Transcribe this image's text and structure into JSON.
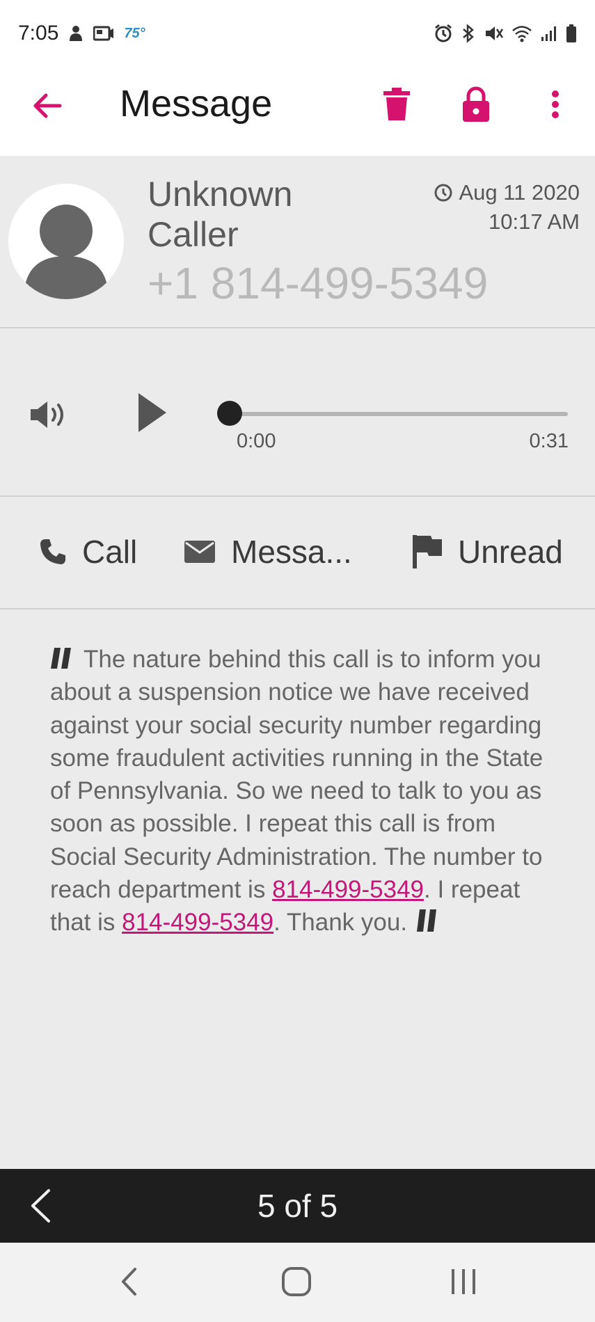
{
  "status_bar": {
    "time": "7:05",
    "temperature": "75°",
    "icons": [
      "profile-icon",
      "news-icon",
      "alarm-icon",
      "bluetooth-icon",
      "mute-icon",
      "wifi-icon",
      "signal-icon",
      "battery-icon"
    ]
  },
  "app_bar": {
    "title": "Message",
    "accent_color": "#d6126f",
    "icons": [
      "back-arrow-icon",
      "trash-icon",
      "lock-icon",
      "more-vert-icon"
    ]
  },
  "caller": {
    "name": "Unknown Caller",
    "number": "+1 814-499-5349",
    "date": "Aug 11 2020",
    "time": "10:17 AM"
  },
  "player": {
    "position": "0:00",
    "duration": "0:31",
    "progress": 0
  },
  "actions": {
    "call": "Call",
    "message": "Messa...",
    "unread": "Unread"
  },
  "transcript": {
    "part1": "The nature behind this call is to inform you about a suspension notice we have received against your social security number regarding some fraudulent activities running in the State of Pennsylvania. So we need to talk to you as soon as possible. I repeat this call is from Social Security Administration. The number to reach department is ",
    "link1": "814-499-5349",
    "part2": ". I repeat that is ",
    "link2": "814-499-5349",
    "part3": ". Thank you."
  },
  "pager": {
    "label": "5 of 5"
  }
}
